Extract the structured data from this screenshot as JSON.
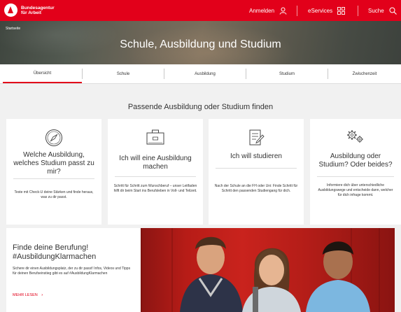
{
  "brand": {
    "line1": "Bundesagentur",
    "line2": "für Arbeit",
    "color": "#e2001a"
  },
  "nav": {
    "login": "Anmelden",
    "eservices": "eServices",
    "search": "Suche"
  },
  "hero": {
    "breadcrumb": "Startseite",
    "title": "Schule, Ausbildung und Studium"
  },
  "tabs": [
    "Übersicht",
    "Schule",
    "Ausbildung",
    "Studium",
    "Zwischenzeit"
  ],
  "section": {
    "title": "Passende Ausbildung oder Studium finden",
    "cards": [
      {
        "icon": "compass-icon",
        "title": "Welche Ausbildung, welches Studium passt zu mir?",
        "text": "Teste mit Check-U deine Stärken und finde heraus, was zu dir passt."
      },
      {
        "icon": "briefcase-icon",
        "title": "Ich will eine Ausbildung machen",
        "text": "Schritt für Schritt zum Wunschberuf – unser Leitfaden hilft dir beim Start ins Berufsleben in Voll- und Teilzeit."
      },
      {
        "icon": "document-pen-icon",
        "title": "Ich will studieren",
        "text": "Nach der Schule an die FH oder Uni: Finde Schritt für Schritt den passenden Studiengang für dich."
      },
      {
        "icon": "gears-icon",
        "title": "Ausbildung oder Studium? Oder beides?",
        "text": "Informiere dich über unterschiedliche Ausbildungswege und entscheide dann, welcher für dich infrage kommt."
      }
    ]
  },
  "promo": {
    "title": "Finde deine Berufung! #AusbildungKlarmachen",
    "text": "Sichere dir einen Ausbildungsplatz, der zu dir passt! Infos, Videos und Tipps für deinen Berufseinstieg gibt es auf #AusbildungKlarmachen",
    "link": "MEHR LESEN"
  }
}
